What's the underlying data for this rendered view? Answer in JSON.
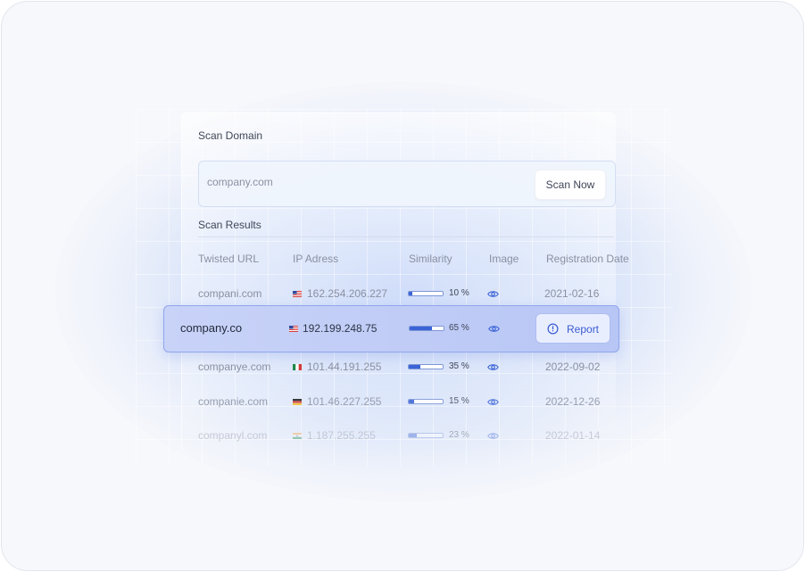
{
  "scan": {
    "title": "Scan Domain",
    "input_value": "company.com",
    "button_label": "Scan Now"
  },
  "results": {
    "title": "Scan Results",
    "columns": [
      "Twisted URL",
      "IP Adress",
      "Similarity",
      "Image",
      "Registration Date"
    ],
    "rows": [
      {
        "url": "compani.com",
        "country": "us",
        "ip": "162.254.206.227",
        "similarity": 10,
        "similarity_label": "10 %",
        "date": "2021-02-16"
      },
      {
        "url": "company.co",
        "country": "us",
        "ip": "192.199.248.75",
        "similarity": 65,
        "similarity_label": "65 %",
        "action": "Report",
        "highlighted": true
      },
      {
        "url": "companye.com",
        "country": "mx",
        "ip": "101.44.191.255",
        "similarity": 35,
        "similarity_label": "35 %",
        "date": "2022-09-02"
      },
      {
        "url": "companie.com",
        "country": "de",
        "ip": "101.46.227.255",
        "similarity": 15,
        "similarity_label": "15 %",
        "date": "2022-12-26"
      },
      {
        "url": "companyl.com",
        "country": "in",
        "ip": "1.187.255.255",
        "similarity": 23,
        "similarity_label": "23 %",
        "date": "2022-01-14"
      }
    ]
  },
  "colors": {
    "accent": "#3a63d6",
    "highlight_row": "#c3cff7"
  }
}
